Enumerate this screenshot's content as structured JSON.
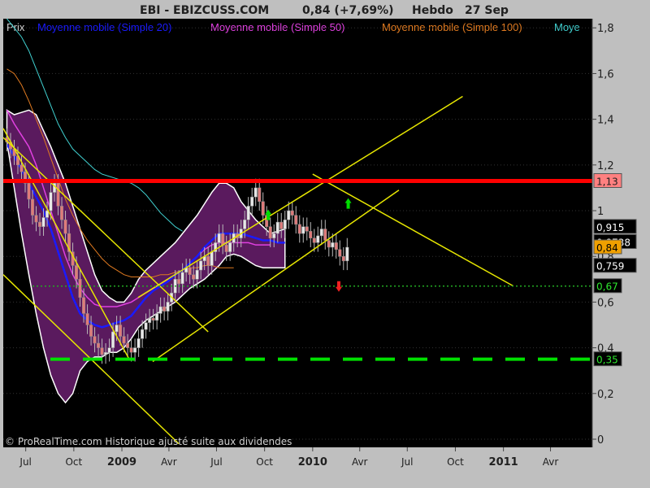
{
  "header": {
    "title": "EBI - EBIZCUSS.COM",
    "quote": "0,84 (+7,69%)",
    "period": "Hebdo",
    "date": "27 Sep"
  },
  "legend": [
    {
      "label": "Prix",
      "color": "#cfcfcf"
    },
    {
      "label": "Moyenne mobile (Simple 20)",
      "color": "#1a1aff"
    },
    {
      "label": "Moyenne mobile (Simple 50)",
      "color": "#e040e0"
    },
    {
      "label": "Moyenne mobile (Simple 100)",
      "color": "#e07a20"
    },
    {
      "label": "Moye",
      "color": "#40d0d0"
    }
  ],
  "copyright": "© ProRealTime.com Historique ajusté suite aux dividendes",
  "colors": {
    "chart_bg": "#000000",
    "frame_bg": "#bfbfbf",
    "candle_up": "#e8e8e8",
    "candle_down": "#e07a7a",
    "bollinger_fill": "#5a1a5e",
    "bollinger_edge": "#ffffff",
    "ma20": "#1a1aff",
    "ma50": "#e040e0",
    "ma100": "#e07a20",
    "ma200": "#40d0d0",
    "trendline": "#e6e600",
    "resistance": "#ff0000",
    "support": "#00e000",
    "dotted": "#22aa22"
  },
  "chart_data": {
    "type": "candlestick",
    "x_ticks": [
      {
        "label": "Jul",
        "date": "2008-07"
      },
      {
        "label": "Oct",
        "date": "2008-10"
      },
      {
        "label": "2009",
        "date": "2009-01",
        "year": true
      },
      {
        "label": "Avr",
        "date": "2009-04"
      },
      {
        "label": "Jul",
        "date": "2009-07"
      },
      {
        "label": "Oct",
        "date": "2009-10"
      },
      {
        "label": "2010",
        "date": "2010-01",
        "year": true
      },
      {
        "label": "Avr",
        "date": "2010-04"
      },
      {
        "label": "Jul",
        "date": "2010-07"
      },
      {
        "label": "Oct",
        "date": "2010-10"
      },
      {
        "label": "2011",
        "date": "2011-01",
        "year": true
      },
      {
        "label": "Avr",
        "date": "2011-04"
      }
    ],
    "x_range": [
      "2008-05-19",
      "2011-06-20"
    ],
    "y_ticks": [
      "1,8",
      "1,6",
      "1,4",
      "1,2",
      "1",
      "0,8",
      "0,6",
      "0,4",
      "0,2",
      "0"
    ],
    "y_range": [
      0,
      1.84
    ],
    "price_badges": [
      {
        "label": "1,13",
        "value": 1.13,
        "bg": "#ff8080",
        "fg": "#202020"
      },
      {
        "label": "0,915",
        "value": 0.915,
        "bg": "#000000",
        "fg": "#ffffff"
      },
      {
        "label": "0,8738",
        "value": 0.8738,
        "bg": "#000000",
        "fg": "#ffffff"
      },
      {
        "label": "0,84",
        "value": 0.84,
        "bg": "#f0a000",
        "fg": "#000000"
      },
      {
        "label": "0,759",
        "value": 0.759,
        "bg": "#000000",
        "fg": "#ffffff"
      },
      {
        "label": "0,67",
        "value": 0.67,
        "bg": "#000000",
        "fg": "#2ee82e"
      },
      {
        "label": "0,35",
        "value": 0.35,
        "bg": "#000000",
        "fg": "#2ee82e"
      }
    ],
    "horizontal_levels": [
      {
        "value": 1.13,
        "style": "solid",
        "role": "resistance"
      },
      {
        "value": 0.67,
        "style": "dotted",
        "role": "dotted"
      },
      {
        "value": 0.35,
        "style": "dashed",
        "role": "support"
      }
    ],
    "candles_weekly_close": [
      1.3,
      1.27,
      1.24,
      1.2,
      1.17,
      1.12,
      1.05,
      0.98,
      0.95,
      0.93,
      0.97,
      1.0,
      1.08,
      1.12,
      1.02,
      0.96,
      0.9,
      0.82,
      0.76,
      0.7,
      0.62,
      0.55,
      0.5,
      0.45,
      0.42,
      0.4,
      0.37,
      0.38,
      0.4,
      0.47,
      0.5,
      0.45,
      0.42,
      0.4,
      0.38,
      0.4,
      0.44,
      0.48,
      0.51,
      0.53,
      0.52,
      0.55,
      0.58,
      0.56,
      0.6,
      0.64,
      0.7,
      0.68,
      0.73,
      0.75,
      0.72,
      0.7,
      0.74,
      0.78,
      0.8,
      0.76,
      0.82,
      0.86,
      0.9,
      0.85,
      0.82,
      0.86,
      0.9,
      0.88,
      0.92,
      0.96,
      1.02,
      1.06,
      1.1,
      1.04,
      0.98,
      0.93,
      0.88,
      0.9,
      0.95,
      0.92,
      0.96,
      1.0,
      0.98,
      0.94,
      0.9,
      0.93,
      0.91,
      0.88,
      0.86,
      0.89,
      0.92,
      0.87,
      0.84,
      0.86,
      0.83,
      0.8,
      0.78,
      0.84
    ],
    "bollinger_upper": [
      1.44,
      1.42,
      1.43,
      1.44,
      1.42,
      1.35,
      1.28,
      1.2,
      1.12,
      1.02,
      0.92,
      0.82,
      0.72,
      0.65,
      0.62,
      0.6,
      0.6,
      0.64,
      0.7,
      0.74,
      0.77,
      0.8,
      0.83,
      0.86,
      0.9,
      0.94,
      0.98,
      1.03,
      1.08,
      1.12,
      1.12,
      1.1,
      1.04,
      1.0,
      0.96,
      0.93,
      0.9,
      0.91,
      0.92
    ],
    "bollinger_lower": [
      1.3,
      1.1,
      0.9,
      0.72,
      0.55,
      0.4,
      0.28,
      0.2,
      0.16,
      0.2,
      0.3,
      0.34,
      0.36,
      0.36,
      0.38,
      0.38,
      0.4,
      0.44,
      0.49,
      0.52,
      0.54,
      0.56,
      0.58,
      0.6,
      0.63,
      0.66,
      0.68,
      0.7,
      0.73,
      0.76,
      0.8,
      0.81,
      0.8,
      0.78,
      0.76,
      0.75,
      0.75,
      0.75,
      0.75
    ],
    "ma20": [
      1.29,
      1.24,
      1.18,
      1.12,
      1.06,
      1.0,
      0.92,
      0.82,
      0.72,
      0.62,
      0.55,
      0.52,
      0.5,
      0.49,
      0.5,
      0.51,
      0.52,
      0.54,
      0.58,
      0.62,
      0.65,
      0.67,
      0.69,
      0.72,
      0.74,
      0.77,
      0.8,
      0.84,
      0.87,
      0.9,
      0.9,
      0.9,
      0.9,
      0.89,
      0.88,
      0.87,
      0.87,
      0.86,
      0.86
    ],
    "ma50": [
      1.44,
      1.38,
      1.33,
      1.28,
      1.2,
      1.1,
      1.0,
      0.9,
      0.8,
      0.72,
      0.66,
      0.62,
      0.59,
      0.58,
      0.58,
      0.58,
      0.59,
      0.6,
      0.62,
      0.64,
      0.66,
      0.68,
      0.7,
      0.72,
      0.74,
      0.77,
      0.8,
      0.83,
      0.85,
      0.86,
      0.86,
      0.86,
      0.86,
      0.86,
      0.85,
      0.85,
      0.85
    ],
    "ma100": [
      1.62,
      1.6,
      1.55,
      1.48,
      1.4,
      1.32,
      1.23,
      1.14,
      1.05,
      0.98,
      0.92,
      0.87,
      0.83,
      0.79,
      0.76,
      0.74,
      0.72,
      0.71,
      0.71,
      0.71,
      0.71,
      0.72,
      0.72,
      0.73,
      0.74,
      0.75,
      0.75,
      0.76,
      0.76,
      0.75,
      0.75,
      0.75
    ],
    "ma200": [
      1.84,
      1.8,
      1.76,
      1.7,
      1.62,
      1.54,
      1.46,
      1.38,
      1.32,
      1.27,
      1.24,
      1.21,
      1.18,
      1.16,
      1.15,
      1.14,
      1.13,
      1.12,
      1.1,
      1.07,
      1.03,
      0.99,
      0.96,
      0.93,
      0.91
    ]
  }
}
